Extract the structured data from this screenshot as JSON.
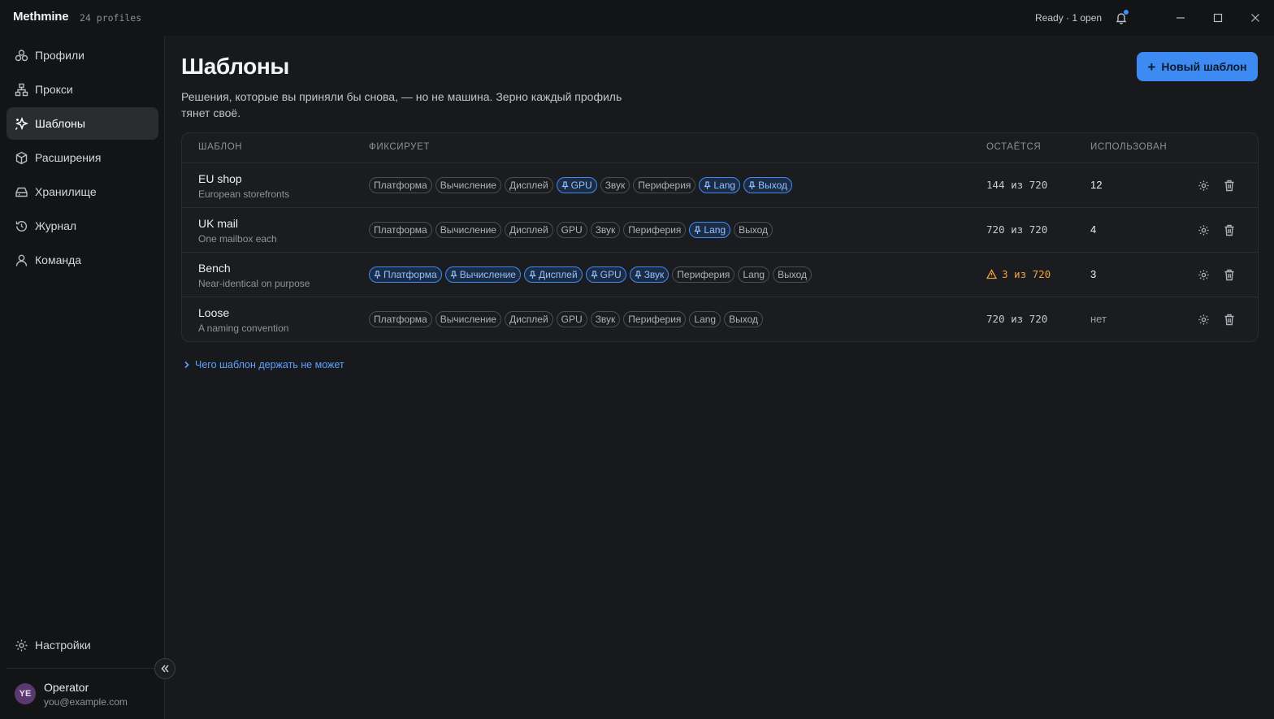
{
  "app": {
    "name": "Methmine",
    "profile_count": "24 profiles",
    "status": "Ready · 1 open"
  },
  "sidebar": {
    "items": [
      {
        "label": "Профили",
        "icon": "profiles-icon"
      },
      {
        "label": "Прокси",
        "icon": "proxy-icon"
      },
      {
        "label": "Шаблоны",
        "icon": "templates-icon",
        "active": true
      },
      {
        "label": "Расширения",
        "icon": "extensions-icon"
      },
      {
        "label": "Хранилище",
        "icon": "storage-icon"
      },
      {
        "label": "Журнал",
        "icon": "history-icon"
      },
      {
        "label": "Команда",
        "icon": "team-icon"
      }
    ],
    "settings_label": "Настройки",
    "user": {
      "initials": "YE",
      "name": "Operator",
      "email": "you@example.com"
    }
  },
  "main": {
    "title": "Шаблоны",
    "subtitle": "Решения, которые вы приняли бы снова, — но не машина. Зерно каждый профиль тянет своё.",
    "new_button_label": "Новый шаблон",
    "disclosure_label": "Чего шаблон держать не может"
  },
  "table": {
    "headers": {
      "name": "ШАБЛОН",
      "fixes": "ФИКСИРУЕТ",
      "remains": "ОСТАЁТСЯ",
      "used": "ИСПОЛЬЗОВАН"
    },
    "rows": [
      {
        "name": "EU shop",
        "desc": "European storefronts",
        "chips": [
          {
            "label": "Платформа",
            "pinned": false
          },
          {
            "label": "Вычисление",
            "pinned": false
          },
          {
            "label": "Дисплей",
            "pinned": false
          },
          {
            "label": "GPU",
            "pinned": true
          },
          {
            "label": "Звук",
            "pinned": false
          },
          {
            "label": "Периферия",
            "pinned": false
          },
          {
            "label": "Lang",
            "pinned": true
          },
          {
            "label": "Выход",
            "pinned": true
          }
        ],
        "remains": "144 из 720",
        "warn": false,
        "used": "12"
      },
      {
        "name": "UK mail",
        "desc": "One mailbox each",
        "chips": [
          {
            "label": "Платформа",
            "pinned": false
          },
          {
            "label": "Вычисление",
            "pinned": false
          },
          {
            "label": "Дисплей",
            "pinned": false
          },
          {
            "label": "GPU",
            "pinned": false
          },
          {
            "label": "Звук",
            "pinned": false
          },
          {
            "label": "Периферия",
            "pinned": false
          },
          {
            "label": "Lang",
            "pinned": true
          },
          {
            "label": "Выход",
            "pinned": false
          }
        ],
        "remains": "720 из 720",
        "warn": false,
        "used": "4"
      },
      {
        "name": "Bench",
        "desc": "Near-identical on purpose",
        "chips": [
          {
            "label": "Платформа",
            "pinned": true
          },
          {
            "label": "Вычисление",
            "pinned": true
          },
          {
            "label": "Дисплей",
            "pinned": true
          },
          {
            "label": "GPU",
            "pinned": true
          },
          {
            "label": "Звук",
            "pinned": true
          },
          {
            "label": "Периферия",
            "pinned": false
          },
          {
            "label": "Lang",
            "pinned": false
          },
          {
            "label": "Выход",
            "pinned": false
          }
        ],
        "remains": "3 из 720",
        "warn": true,
        "used": "3"
      },
      {
        "name": "Loose",
        "desc": "A naming convention",
        "chips": [
          {
            "label": "Платформа",
            "pinned": false
          },
          {
            "label": "Вычисление",
            "pinned": false
          },
          {
            "label": "Дисплей",
            "pinned": false
          },
          {
            "label": "GPU",
            "pinned": false
          },
          {
            "label": "Звук",
            "pinned": false
          },
          {
            "label": "Периферия",
            "pinned": false
          },
          {
            "label": "Lang",
            "pinned": false
          },
          {
            "label": "Выход",
            "pinned": false
          }
        ],
        "remains": "720 из 720",
        "warn": false,
        "used": "нет"
      }
    ]
  },
  "colors": {
    "accent": "#3d8bf2",
    "warning": "#f0a13a",
    "background": "#18191c",
    "sidebar": "#131416"
  }
}
